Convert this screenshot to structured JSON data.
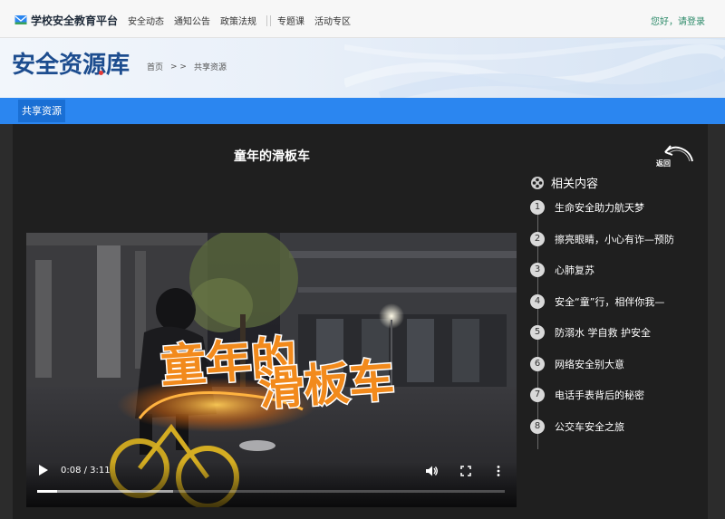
{
  "header": {
    "logo_text": "学校安全教育平台",
    "nav": [
      "安全动态",
      "通知公告",
      "政策法规",
      "专题课",
      "活动专区"
    ],
    "login": "您好，请登录"
  },
  "banner": {
    "title": "安全资源库",
    "breadcrumb": {
      "home": "首页",
      "arrows": "> >",
      "current": "共享资源"
    }
  },
  "tabbar": {
    "active_tab": "共享资源"
  },
  "video": {
    "title": "童年的滑板车",
    "overlay_line1": "童年的",
    "overlay_line2": "滑板车",
    "time": "0:08 / 3:11",
    "progress_fraction": 0.042,
    "buffered_fraction": 0.29
  },
  "back": {
    "label": "返回"
  },
  "related": {
    "title": "相关内容",
    "items": [
      {
        "num": "1",
        "label": "生命安全助力航天梦"
      },
      {
        "num": "2",
        "label": "擦亮眼睛，小心有诈—预防"
      },
      {
        "num": "3",
        "label": "心肺复苏"
      },
      {
        "num": "4",
        "label": "安全“童”行，相伴你我—"
      },
      {
        "num": "5",
        "label": "防溺水 学自救 护安全"
      },
      {
        "num": "6",
        "label": "网络安全别大意"
      },
      {
        "num": "7",
        "label": "电话手表背后的秘密"
      },
      {
        "num": "8",
        "label": "公交车安全之旅"
      }
    ]
  },
  "colors": {
    "accent_blue": "#2b86f0",
    "tab_blue": "#1a6fd4",
    "title_blue": "#1d4d8f",
    "login_green": "#2e8b6a",
    "overlay_orange": "#f28a1c"
  }
}
